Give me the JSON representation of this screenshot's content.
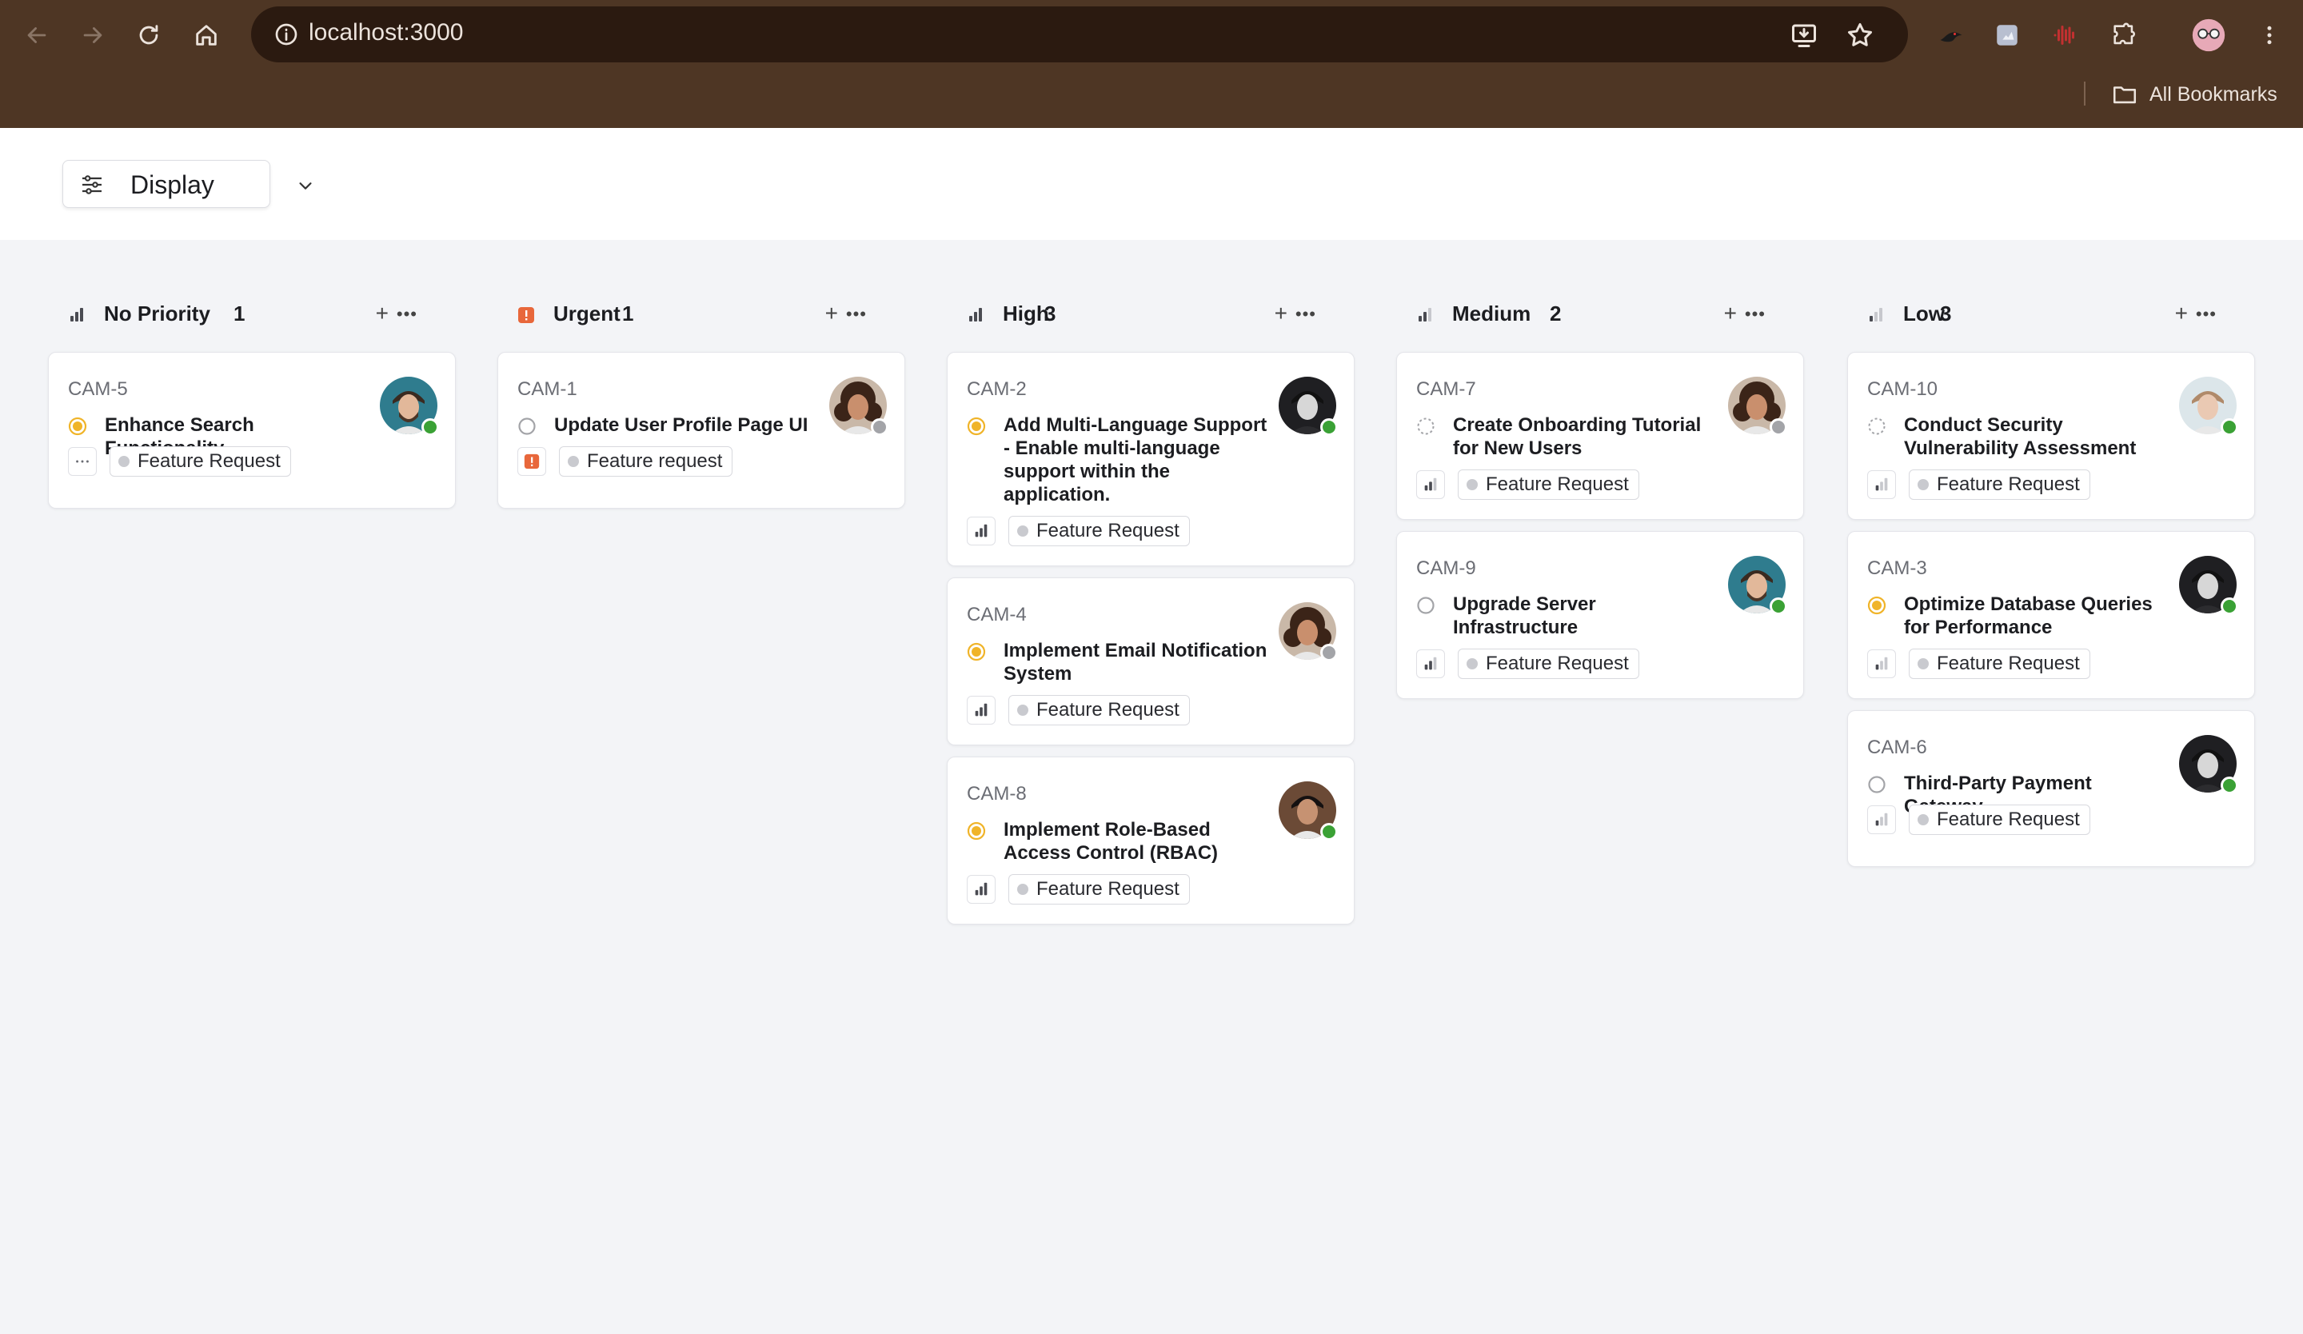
{
  "browser": {
    "url": "localhost:3000",
    "bookmarks_label": "All Bookmarks"
  },
  "toolbar": {
    "display_label": "Display"
  },
  "colors": {
    "urgent": "#e8673b",
    "in_progress": "#f0b429",
    "online": "#3aa135",
    "offline": "#a3a4a8"
  },
  "columns": [
    {
      "title": "No Priority",
      "count": "1",
      "priority_icon": "no-priority-icon",
      "cards": [
        {
          "id": "CAM-5",
          "title": "Enhance Search Functionality",
          "status": "in-progress",
          "priority": "no-priority",
          "tag": "Feature Request",
          "presence": "online",
          "avatar": "man-with-beard"
        }
      ]
    },
    {
      "title": "Urgent",
      "count": "1",
      "priority_icon": "urgent-icon",
      "cards": [
        {
          "id": "CAM-1",
          "title": "Update User Profile Page UI",
          "status": "todo",
          "priority": "urgent",
          "tag": "Feature request",
          "presence": "offline",
          "avatar": "woman-curly-hair"
        }
      ]
    },
    {
      "title": "High",
      "count": "3",
      "priority_icon": "high-priority-icon",
      "cards": [
        {
          "id": "CAM-2",
          "title": "Add Multi-Language Support - Enable multi-language support within the application.",
          "status": "in-progress",
          "priority": "high",
          "tag": "Feature Request",
          "presence": "online",
          "avatar": "dark-portrait"
        },
        {
          "id": "CAM-4",
          "title": "Implement Email Notification System",
          "status": "in-progress",
          "priority": "high",
          "tag": "Feature Request",
          "presence": "offline",
          "avatar": "woman-curly-hair"
        },
        {
          "id": "CAM-8",
          "title": "Implement Role-Based Access Control (RBAC)",
          "status": "in-progress",
          "priority": "high",
          "tag": "Feature Request",
          "presence": "online",
          "avatar": "man-dark-hair"
        }
      ]
    },
    {
      "title": "Medium",
      "count": "2",
      "priority_icon": "medium-priority-icon",
      "cards": [
        {
          "id": "CAM-7",
          "title": "Create Onboarding Tutorial for New Users",
          "status": "backlog",
          "priority": "medium",
          "tag": "Feature Request",
          "presence": "offline",
          "avatar": "woman-curly-hair"
        },
        {
          "id": "CAM-9",
          "title": "Upgrade Server Infrastructure",
          "status": "todo",
          "priority": "medium",
          "tag": "Feature Request",
          "presence": "online",
          "avatar": "man-with-beard"
        }
      ]
    },
    {
      "title": "Low",
      "count": "3",
      "priority_icon": "low-priority-icon",
      "cards": [
        {
          "id": "CAM-10",
          "title": "Conduct Security Vulnerability Assessment",
          "status": "backlog",
          "priority": "low",
          "tag": "Feature Request",
          "presence": "online",
          "avatar": "woman-light-hair"
        },
        {
          "id": "CAM-3",
          "title": "Optimize Database Queries for Performance",
          "status": "in-progress",
          "priority": "low",
          "tag": "Feature Request",
          "presence": "online",
          "avatar": "dark-portrait"
        },
        {
          "id": "CAM-6",
          "title": "Third-Party Payment Gateway",
          "status": "todo",
          "priority": "low",
          "tag": "Feature Request",
          "presence": "online",
          "avatar": "dark-portrait"
        }
      ]
    }
  ]
}
